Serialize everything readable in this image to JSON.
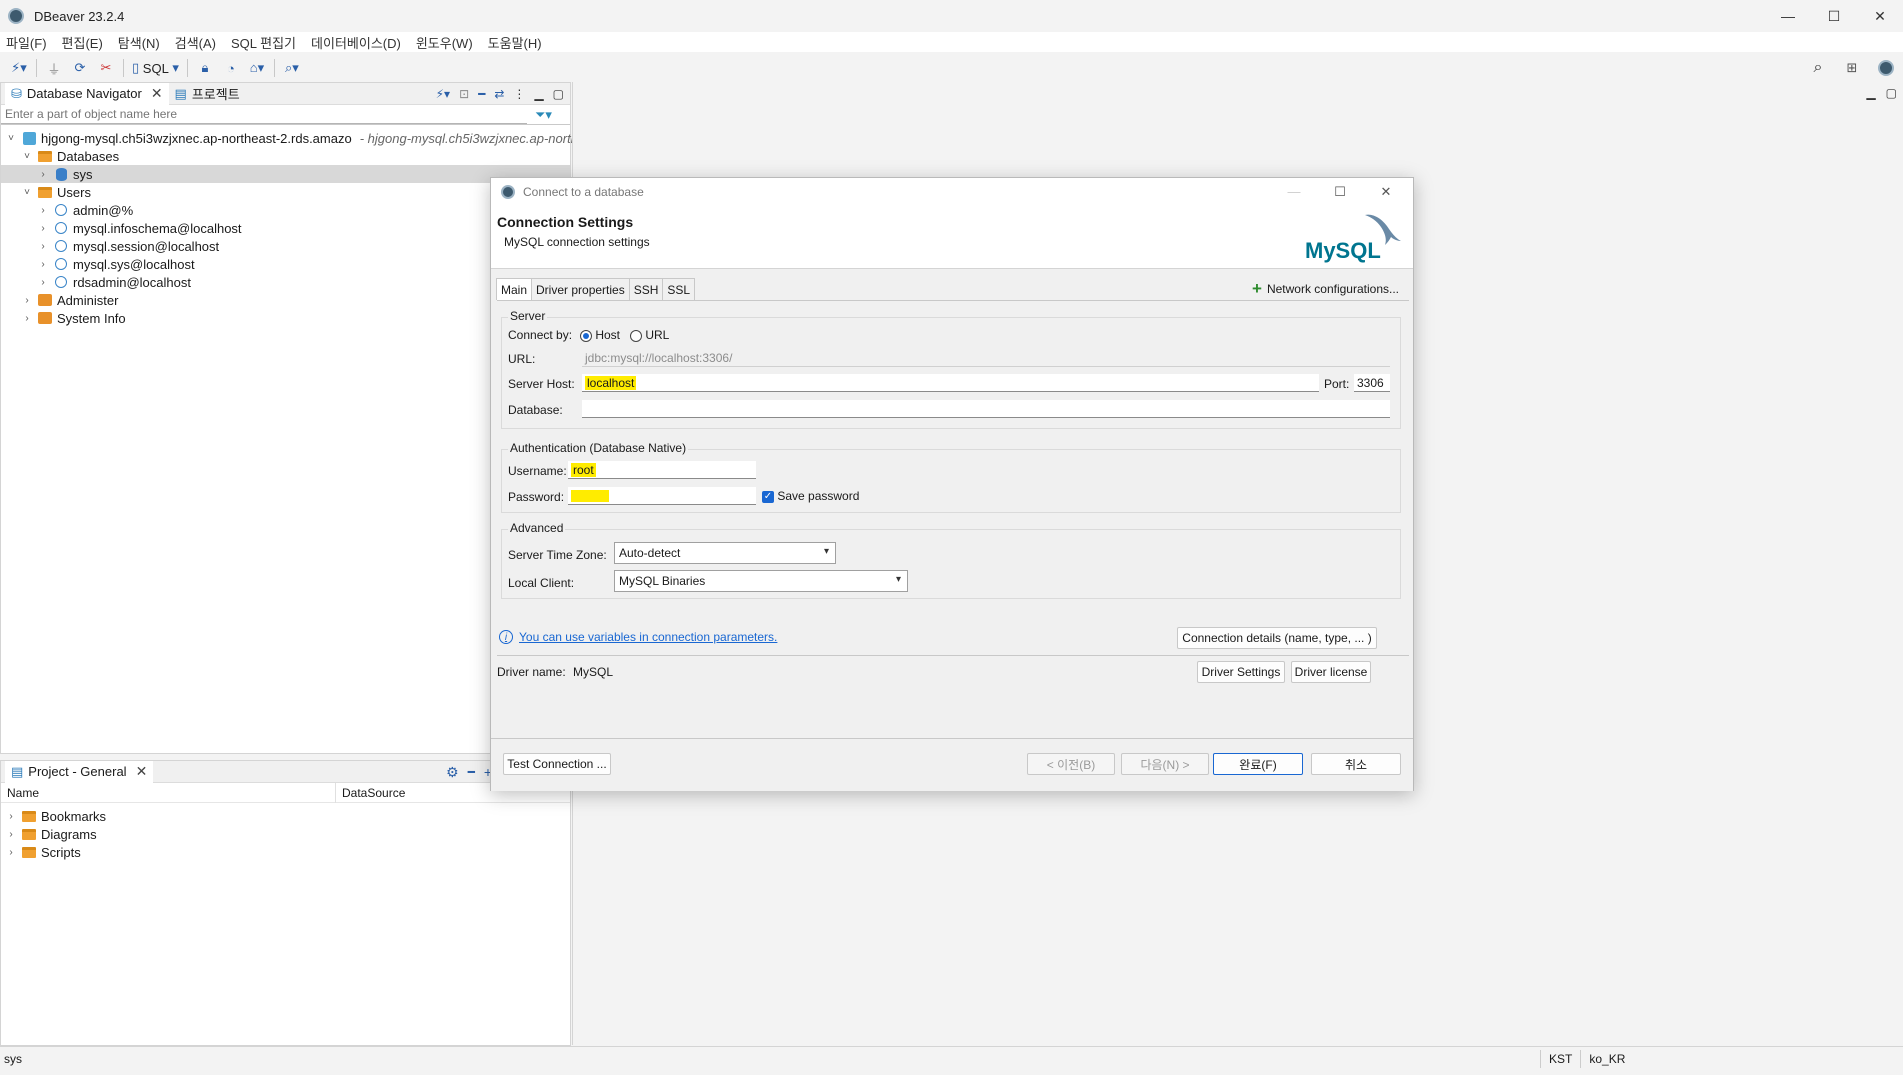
{
  "window": {
    "title": "DBeaver 23.2.4",
    "min": "—",
    "max": "☐",
    "close": "✕"
  },
  "menu": [
    "파일(F)",
    "편집(E)",
    "탐색(N)",
    "검색(A)",
    "SQL 편집기",
    "데이터베이스(D)",
    "윈도우(W)",
    "도움말(H)"
  ],
  "toolbar": {
    "sql_label": "SQL"
  },
  "navigator": {
    "tab_label": "Database Navigator",
    "tab2_label": "프로젝트",
    "filter_placeholder": "Enter a part of object name here",
    "connection": "hjgong-mysql.ch5i3wzjxnec.ap-northeast-2.rds.amazo",
    "connection_sub": "- hjgong-mysql.ch5i3wzjxnec.ap-northeas",
    "databases": "Databases",
    "sys": "sys",
    "users": "Users",
    "user_items": [
      "admin@%",
      "mysql.infoschema@localhost",
      "mysql.session@localhost",
      "mysql.sys@localhost",
      "rdsadmin@localhost"
    ],
    "administer": "Administer",
    "system_info": "System Info"
  },
  "project": {
    "tab_label": "Project - General",
    "col_name": "Name",
    "col_datasource": "DataSource",
    "items": [
      "Bookmarks",
      "Diagrams",
      "Scripts"
    ]
  },
  "status": {
    "left": "sys",
    "tz": "KST",
    "locale": "ko_KR"
  },
  "dialog": {
    "title": "Connect to a database",
    "heading": "Connection Settings",
    "subheading": "MySQL connection settings",
    "logo_text": "MySQL",
    "tabs": [
      "Main",
      "Driver properties",
      "SSH",
      "SSL"
    ],
    "network_config": "Network configurations...",
    "server_group": "Server",
    "connect_by_label": "Connect by:",
    "opt_host": "Host",
    "opt_url": "URL",
    "url_label": "URL:",
    "url_value": "jdbc:mysql://localhost:3306/",
    "host_label": "Server Host:",
    "host_value": "localhost",
    "port_label": "Port:",
    "port_value": "3306",
    "database_label": "Database:",
    "database_value": "",
    "auth_group": "Authentication (Database Native)",
    "username_label": "Username:",
    "username_value": "root",
    "password_label": "Password:",
    "save_password": "Save password",
    "advanced_group": "Advanced",
    "tz_label": "Server Time Zone:",
    "tz_value": "Auto-detect",
    "client_label": "Local Client:",
    "client_value": "MySQL Binaries",
    "info_link": "You can use variables in connection parameters.",
    "conn_details": "Connection details (name, type, ... )",
    "driver_name_label": "Driver name:",
    "driver_name_value": "MySQL",
    "driver_settings": "Driver Settings",
    "driver_license": "Driver license",
    "test_connection": "Test Connection ...",
    "back": "< 이전(B)",
    "next": "다음(N) >",
    "finish": "완료(F)",
    "cancel": "취소"
  }
}
